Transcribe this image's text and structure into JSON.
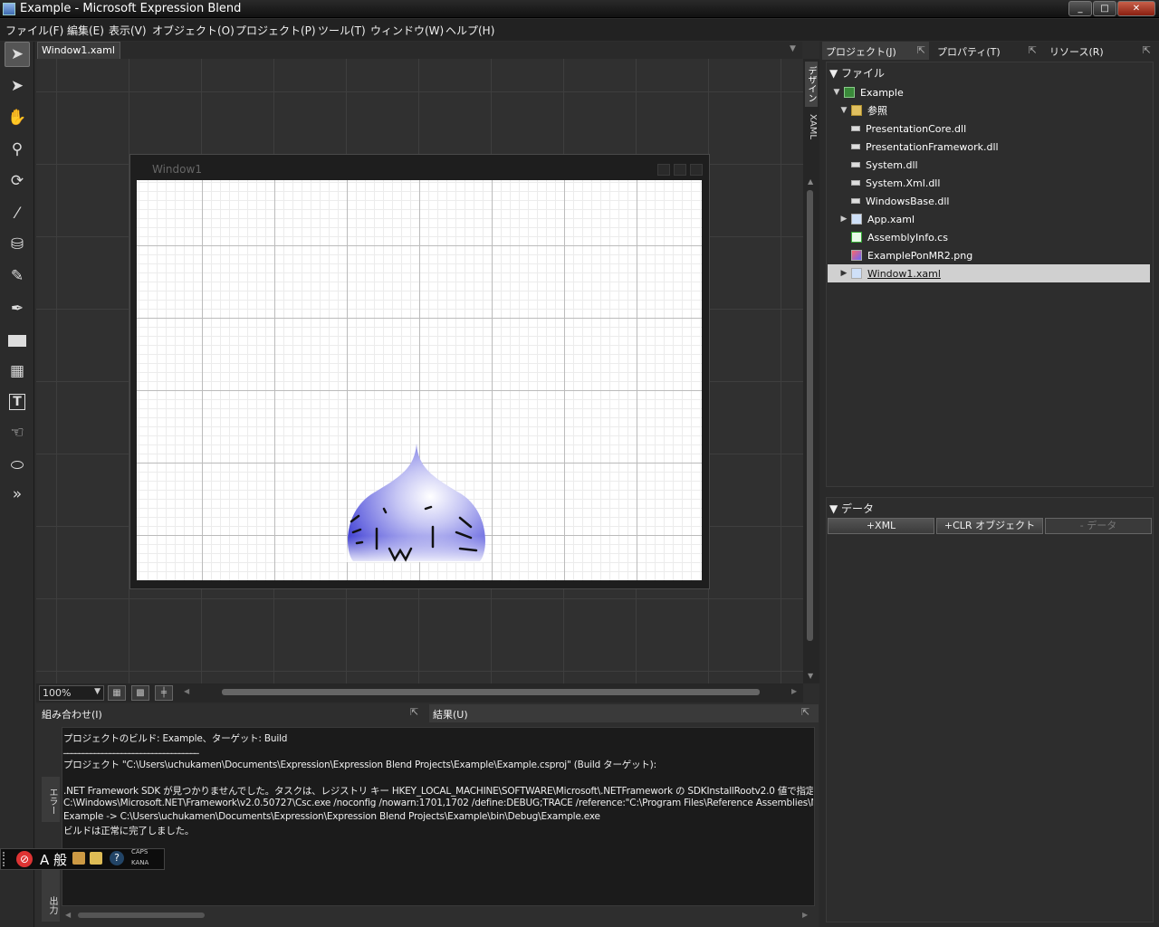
{
  "window": {
    "title": "Example - Microsoft Expression Blend",
    "min": "_",
    "max": "□",
    "close": "✕"
  },
  "menu": [
    "ファイル(F)",
    "編集(E)",
    "表示(V)",
    "オブジェクト(O)",
    "プロジェクト(P)",
    "ツール(T)",
    "ウィンドウ(W)",
    "ヘルプ(H)"
  ],
  "doc_tab": {
    "label": "Window1.xaml",
    "close": "×"
  },
  "artboard": {
    "window_title": "Window1"
  },
  "side_tabs": {
    "design": "デザイン",
    "xaml": "XAML"
  },
  "statusbar": {
    "zoom": "100%"
  },
  "bottom": {
    "left_title": "組み合わせ(I)",
    "right_title": "結果(U)",
    "vtab_error": "エラー",
    "vtab_output": "出力",
    "output": [
      "プロジェクトのビルド: Example、ターゲット: Build",
      "___________________________________",
      "プロジェクト \"C:\\Users\\uchukamen\\Documents\\Expression\\Expression Blend Projects\\Example\\Example.csproj\" (Build ターゲット):",
      "",
      ".NET Framework SDK が見つかりませんでした。タスクは、レジストリ キー HKEY_LOCAL_MACHINE\\SOFTWARE\\Microsoft\\.NETFramework の SDKInstallRootv2.0 値で指定",
      "C:\\Windows\\Microsoft.NET\\Framework\\v2.0.50727\\Csc.exe /noconfig /nowarn:1701,1702 /define:DEBUG;TRACE /reference:\"C:\\Program Files\\Reference Assemblies\\Microso",
      "Example -> C:\\Users\\uchukamen\\Documents\\Expression\\Expression Blend Projects\\Example\\bin\\Debug\\Example.exe",
      "ビルドは正常に完了しました。"
    ]
  },
  "right": {
    "tabs": [
      "プロジェクト(J)",
      "プロパティ(T)",
      "リソース(R)"
    ],
    "files_header": "▼ ファイル",
    "tree": [
      {
        "label": "Example",
        "toggle": "▼"
      },
      {
        "label": "参照",
        "toggle": "▼"
      },
      {
        "label": "PresentationCore.dll",
        "toggle": ""
      },
      {
        "label": "PresentationFramework.dll",
        "toggle": ""
      },
      {
        "label": "System.dll",
        "toggle": ""
      },
      {
        "label": "System.Xml.dll",
        "toggle": ""
      },
      {
        "label": "WindowsBase.dll",
        "toggle": ""
      },
      {
        "label": "App.xaml",
        "toggle": "▶"
      },
      {
        "label": "AssemblyInfo.cs",
        "toggle": ""
      },
      {
        "label": "ExamplePonMR2.png",
        "toggle": ""
      },
      {
        "label": "Window1.xaml",
        "toggle": "▶"
      }
    ],
    "data_header": "▼ データ",
    "data_buttons": [
      "+XML",
      "+CLR オブジェクト",
      "- データ"
    ]
  },
  "tray": {
    "caps": "CAPS",
    "kana": "KANA",
    "ime": "A 般",
    "help": "?"
  }
}
